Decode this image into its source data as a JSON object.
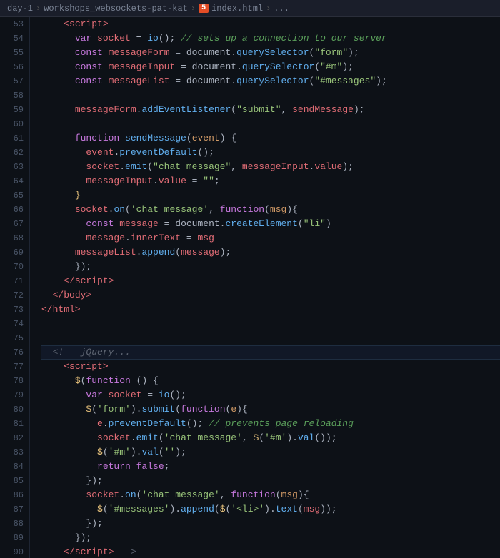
{
  "breadcrumb": {
    "parts": [
      "day-1",
      ">",
      "workshops_websockets-pat-kat",
      ">",
      "index.html",
      ">",
      "..."
    ],
    "html_badge": "5"
  },
  "lines": [
    {
      "num": 53,
      "content": ""
    },
    {
      "num": 54,
      "content": ""
    },
    {
      "num": 55,
      "content": ""
    },
    {
      "num": 56,
      "content": ""
    },
    {
      "num": 57,
      "content": ""
    },
    {
      "num": 58,
      "content": ""
    },
    {
      "num": 59,
      "content": ""
    },
    {
      "num": 60,
      "content": ""
    },
    {
      "num": 61,
      "content": ""
    },
    {
      "num": 62,
      "content": ""
    },
    {
      "num": 63,
      "content": ""
    },
    {
      "num": 64,
      "content": ""
    },
    {
      "num": 65,
      "content": ""
    },
    {
      "num": 66,
      "content": ""
    },
    {
      "num": 67,
      "content": ""
    },
    {
      "num": 68,
      "content": ""
    },
    {
      "num": 69,
      "content": ""
    },
    {
      "num": 70,
      "content": ""
    },
    {
      "num": 71,
      "content": ""
    },
    {
      "num": 72,
      "content": ""
    },
    {
      "num": 73,
      "content": ""
    },
    {
      "num": 74,
      "content": ""
    },
    {
      "num": 75,
      "content": ""
    },
    {
      "num": 76,
      "content": ""
    },
    {
      "num": 77,
      "content": ""
    },
    {
      "num": 78,
      "content": ""
    },
    {
      "num": 79,
      "content": ""
    },
    {
      "num": 80,
      "content": ""
    },
    {
      "num": 81,
      "content": ""
    },
    {
      "num": 82,
      "content": ""
    },
    {
      "num": 83,
      "content": ""
    },
    {
      "num": 84,
      "content": ""
    },
    {
      "num": 85,
      "content": ""
    },
    {
      "num": 86,
      "content": ""
    },
    {
      "num": 87,
      "content": ""
    },
    {
      "num": 88,
      "content": ""
    },
    {
      "num": 89,
      "content": ""
    },
    {
      "num": 90,
      "content": ""
    }
  ]
}
